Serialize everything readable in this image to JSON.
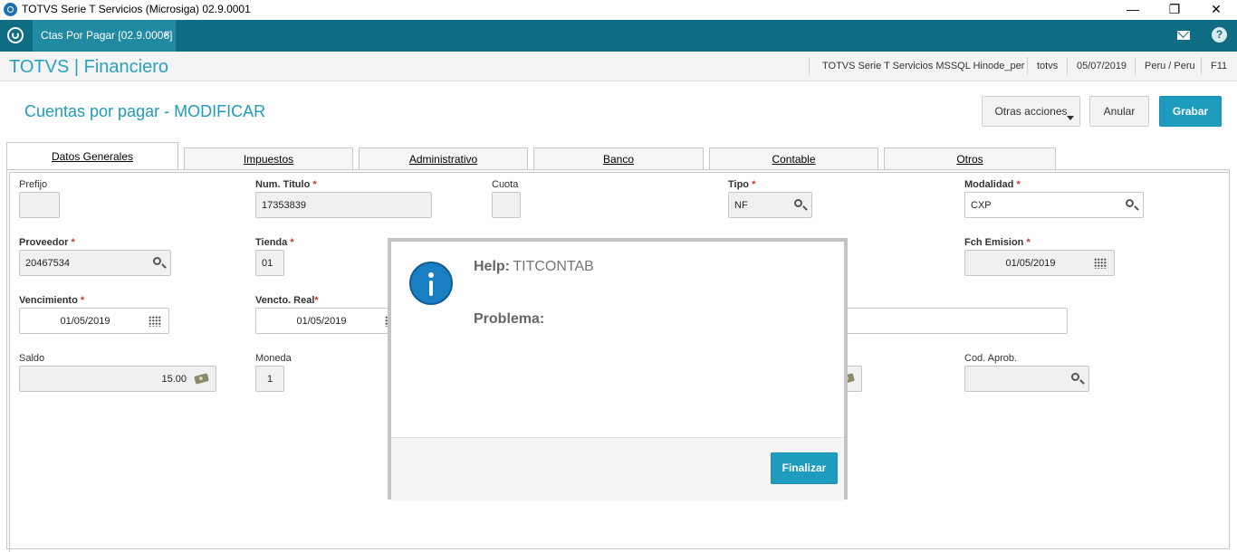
{
  "window": {
    "title": "TOTVS Serie T Servicios (Microsiga) 02.9.0001",
    "minimize": "—",
    "restore": "❐",
    "close": "✕"
  },
  "tabbar": {
    "tab_label": "Ctas Por Pagar [02.9.0006]",
    "tab_close": "×",
    "help": "?"
  },
  "header": {
    "brand": "TOTVS | Financiero",
    "env": "TOTVS Serie T Servicios MSSQL Hinode_per",
    "user": "totvs",
    "date": "05/07/2019",
    "region": "Peru / Peru",
    "key": "F11"
  },
  "page": {
    "title": "Cuentas por pagar - MODIFICAR",
    "actions": {
      "otras": "Otras acciones",
      "anular": "Anular",
      "grabar": "Grabar"
    }
  },
  "tabs": [
    "Datos Generales",
    "Impuestos",
    "Administrativo",
    "Banco",
    "Contable",
    "Otros"
  ],
  "fields": {
    "prefijo": {
      "label": "Prefijo",
      "value": ""
    },
    "num_titulo": {
      "label": "Num. Titulo",
      "value": "17353839"
    },
    "cuota": {
      "label": "Cuota",
      "value": ""
    },
    "tipo": {
      "label": "Tipo",
      "value": "NF"
    },
    "modalidad": {
      "label": "Modalidad",
      "value": "CXP"
    },
    "proveedor": {
      "label": "Proveedor",
      "value": "20467534"
    },
    "tienda": {
      "label": "Tienda",
      "value": "01"
    },
    "fch_emision": {
      "label": "Fch Emision",
      "value": "01/05/2019"
    },
    "vencimiento": {
      "label": "Vencimiento",
      "value": "01/05/2019"
    },
    "vencto_real": {
      "label": "Vencto. Real",
      "value": "01/05/2019"
    },
    "saldo": {
      "label": "Saldo",
      "value": "15.00"
    },
    "moneda": {
      "label": "Moneda",
      "value": "1"
    },
    "cod_aprob": {
      "label": "Cod. Aprob.",
      "value": ""
    },
    "required_mark": "*"
  },
  "modal": {
    "help_label": "Help:",
    "help_value": "TITCONTAB",
    "problema_label": "Problema:",
    "finalizar": "Finalizar"
  },
  "colors": {
    "teal_bar": "#0e6d82",
    "accent": "#1e9cc0",
    "required": "#d9302c"
  }
}
